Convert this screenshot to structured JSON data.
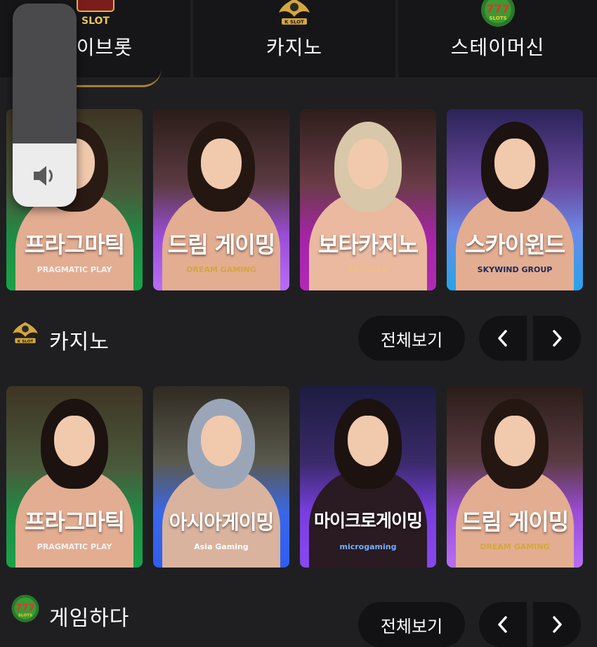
{
  "tabs": [
    {
      "label": "라이브롯",
      "logo": "live-slot-logo"
    },
    {
      "label": "카지노",
      "logo": "k-slot-logo"
    },
    {
      "label": "스테이머신",
      "logo": "777-slots-logo"
    }
  ],
  "logo_text": {
    "live_slot": "SLOT",
    "k_slot": "K SLOT",
    "slots_777": "SLOTS"
  },
  "volume": {
    "icon": "speaker-icon",
    "level": 0.31
  },
  "row1": [
    {
      "title": "프라그마틱",
      "provider": "PRAGMATIC PLAY",
      "color": "#1aa347"
    },
    {
      "title": "드림 게이밍",
      "provider": "DREAM GAMING",
      "color": "#b66ef4"
    },
    {
      "title": "보타카지노",
      "provider": "TG TIGER",
      "color": "#b229b5"
    },
    {
      "title": "스카이윈드",
      "provider": "SKYWIND GROUP",
      "color": "#25a4e8"
    }
  ],
  "casino_section": {
    "title": "카지노",
    "view_all": "전체보기",
    "prev_icon": "chevron-left-icon",
    "next_icon": "chevron-right-icon"
  },
  "row2": [
    {
      "title": "프라그마틱",
      "provider": "PRAGMATIC PLAY",
      "color": "#1aa347"
    },
    {
      "title": "아시아게이밍",
      "provider": "Asia Gaming",
      "color": "#2f5df0"
    },
    {
      "title": "마이크로게이밍",
      "provider": "microgaming",
      "color": "#8848ee"
    },
    {
      "title": "드림 게이밍",
      "provider": "DREAM GAMING",
      "color": "#b66ef4"
    }
  ],
  "game_section": {
    "title": "게임하다",
    "view_all": "전체보기"
  },
  "colors": {
    "background": "#1f1f22",
    "tab_bg": "#161618",
    "button_bg": "#121214",
    "gold": "#d4a73c"
  }
}
